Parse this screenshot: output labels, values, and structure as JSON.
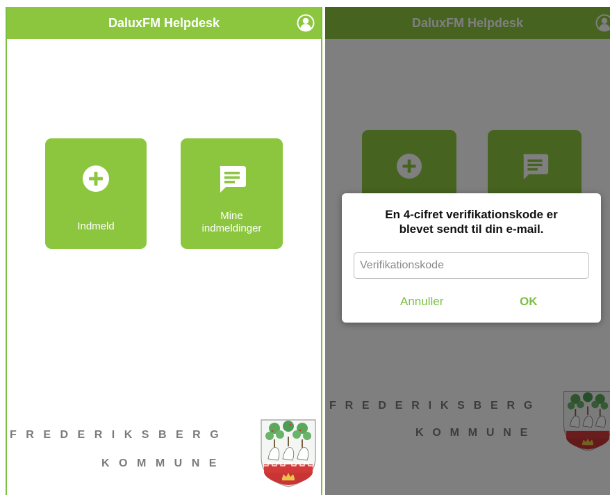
{
  "app": {
    "title": "DaluxFM Helpdesk"
  },
  "tiles": {
    "report": {
      "label": "Indmeld"
    },
    "my_reports": {
      "label_line1": "Mine",
      "label_line2": "indmeldinger"
    }
  },
  "branding": {
    "line1": "FREDERIKSBERG",
    "line2": "KOMMUNE"
  },
  "dialog": {
    "message_line1": "En 4-cifret verifikationskode er",
    "message_line2": "blevet sendt til din e-mail.",
    "input_placeholder": "Verifikationskode",
    "input_value": "",
    "cancel_label": "Annuller",
    "ok_label": "OK"
  },
  "colors": {
    "brand_green": "#8cc63f",
    "dim_overlay": "rgba(0,0,0,0.5)",
    "text_grey": "#7a7a7a"
  },
  "icons": {
    "user": "user-circle-icon",
    "add": "plus-circle-icon",
    "messages": "chat-bubble-icon"
  }
}
